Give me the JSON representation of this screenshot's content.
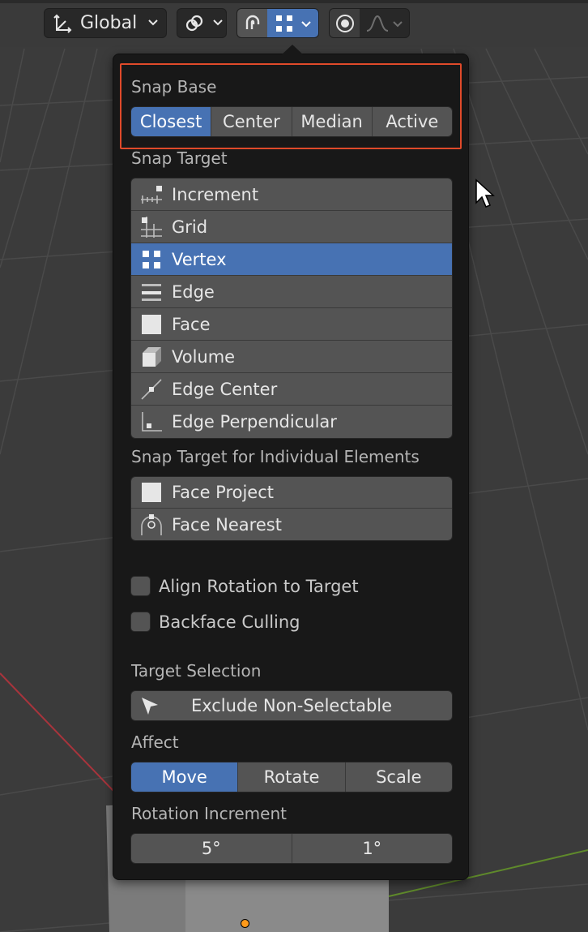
{
  "toolbar": {
    "orientation_label": "Global"
  },
  "popover": {
    "snap_base": {
      "label": "Snap Base",
      "options": [
        "Closest",
        "Center",
        "Median",
        "Active"
      ],
      "selected": "Closest"
    },
    "snap_target": {
      "label": "Snap Target",
      "items": [
        {
          "label": "Increment",
          "icon": "increment-icon"
        },
        {
          "label": "Grid",
          "icon": "grid-icon"
        },
        {
          "label": "Vertex",
          "icon": "vertex-icon",
          "selected": true
        },
        {
          "label": "Edge",
          "icon": "edge-icon"
        },
        {
          "label": "Face",
          "icon": "face-icon"
        },
        {
          "label": "Volume",
          "icon": "volume-icon"
        },
        {
          "label": "Edge Center",
          "icon": "edge-center-icon"
        },
        {
          "label": "Edge Perpendicular",
          "icon": "edge-perpendicular-icon"
        }
      ]
    },
    "individual": {
      "label": "Snap Target for Individual Elements",
      "items": [
        {
          "label": "Face Project",
          "icon": "face-project-icon"
        },
        {
          "label": "Face Nearest",
          "icon": "face-nearest-icon"
        }
      ]
    },
    "align_rotation": {
      "label": "Align Rotation to Target",
      "checked": false
    },
    "backface_culling": {
      "label": "Backface Culling",
      "checked": false
    },
    "target_selection": {
      "label": "Target Selection",
      "value": "Exclude Non-Selectable"
    },
    "affect": {
      "label": "Affect",
      "options": [
        "Move",
        "Rotate",
        "Scale"
      ],
      "selected": "Move"
    },
    "rotation_increment": {
      "label": "Rotation Increment",
      "values": [
        "5°",
        "1°"
      ]
    }
  },
  "colors": {
    "accent": "#4772b3",
    "highlight_border": "#e04a2a",
    "panel_bg": "#181818",
    "button_bg": "#545454"
  }
}
